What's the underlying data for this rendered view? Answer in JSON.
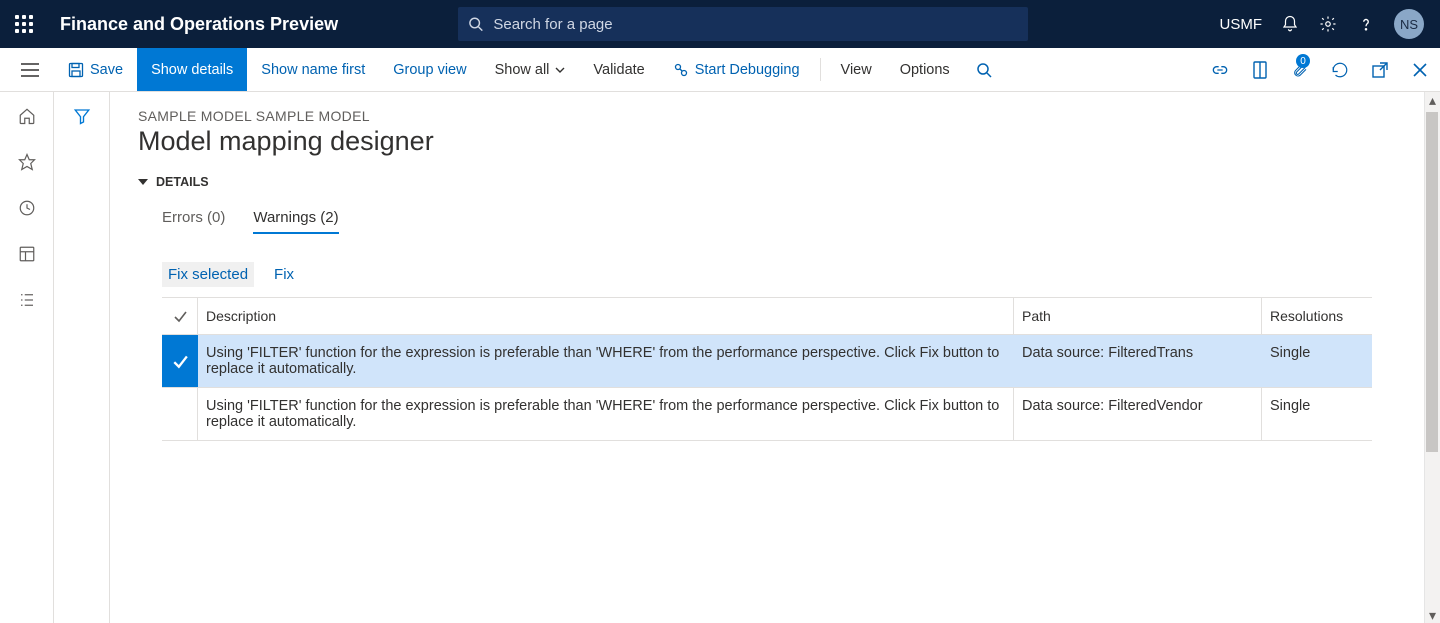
{
  "header": {
    "app_title": "Finance and Operations Preview",
    "search_placeholder": "Search for a page",
    "company": "USMF",
    "avatar_initials": "NS"
  },
  "cmdbar": {
    "save": "Save",
    "show_details": "Show details",
    "show_name_first": "Show name first",
    "group_view": "Group view",
    "show_all": "Show all",
    "validate": "Validate",
    "start_debugging": "Start Debugging",
    "view": "View",
    "options": "Options",
    "attachment_count": "0"
  },
  "page": {
    "breadcrumb": "SAMPLE MODEL SAMPLE MODEL",
    "title": "Model mapping designer",
    "details_label": "DETAILS"
  },
  "tabs": {
    "errors": "Errors (0)",
    "warnings": "Warnings (2)"
  },
  "actions": {
    "fix_selected": "Fix selected",
    "fix": "Fix"
  },
  "grid": {
    "headers": {
      "description": "Description",
      "path": "Path",
      "resolutions": "Resolutions"
    },
    "rows": [
      {
        "selected": true,
        "description": "Using 'FILTER' function for the expression is preferable than 'WHERE' from the performance perspective. Click Fix button to replace it automatically.",
        "path": "Data source: FilteredTrans",
        "resolutions": "Single"
      },
      {
        "selected": false,
        "description": "Using 'FILTER' function for the expression is preferable than 'WHERE' from the performance perspective. Click Fix button to replace it automatically.",
        "path": "Data source: FilteredVendor",
        "resolutions": "Single"
      }
    ]
  }
}
